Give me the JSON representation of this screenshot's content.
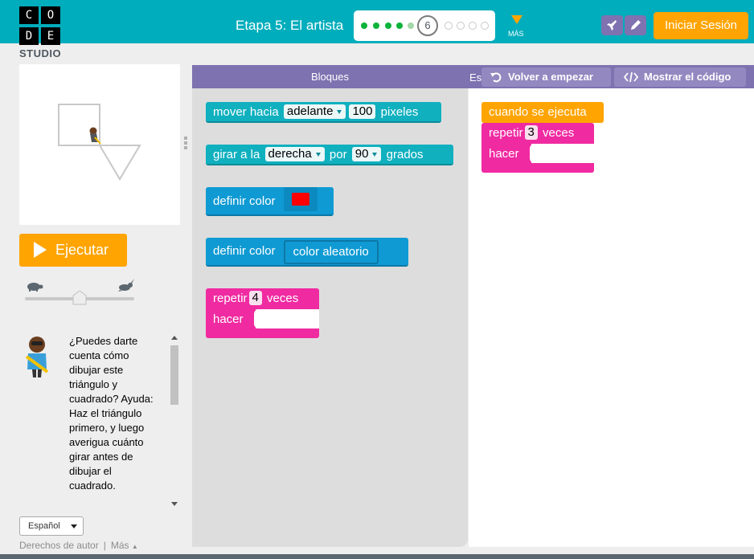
{
  "header": {
    "logo_letters": [
      "C",
      "O",
      "D",
      "E"
    ],
    "logo_sub": "STUDIO",
    "stage_title": "Etapa 5: El artista",
    "current_level": "6",
    "more_label": "MÁS",
    "signin_label": "Iniciar Sesión",
    "icons": [
      "rocket-icon",
      "pencil-icon"
    ]
  },
  "run_button": {
    "label": "Ejecutar"
  },
  "speed_slider": {
    "value": 0.5,
    "slow_icon": "turtle-icon",
    "fast_icon": "rabbit-icon"
  },
  "instructions": {
    "lines": [
      "¿Puedes darte",
      "cuenta cómo",
      "dibujar este",
      "triángulo y",
      "cuadrado? Ayuda:",
      "Haz el triángulo",
      "primero, y luego",
      "averigua cuánto",
      "girar antes de",
      "dibujar el",
      "cuadrado."
    ]
  },
  "footer": {
    "language": "Español",
    "copyright": "Derechos de autor",
    "more": "Más"
  },
  "toolbox": {
    "title": "Bloques",
    "blocks": {
      "move": {
        "label": "mover hacia",
        "direction": "adelante",
        "amount": "100",
        "unit": "pixeles"
      },
      "turn": {
        "label": "girar a la",
        "direction": "derecha",
        "by": "por",
        "amount": "90",
        "unit": "grados"
      },
      "set_color": {
        "label": "definir color",
        "color": "#ff0000"
      },
      "set_random": {
        "label": "definir color",
        "value": "color aleatorio"
      },
      "repeat": {
        "label": "repetir",
        "count": "4",
        "unit": "veces",
        "do": "hacer"
      }
    }
  },
  "workspace": {
    "label_fragment": "Es",
    "reset_label": "Volver a empezar",
    "code_label": "Mostrar el código",
    "when_run": "cuando se ejecuta",
    "repeat": {
      "label": "repetir",
      "count": "3",
      "unit": "veces",
      "do": "hacer"
    }
  },
  "colors": {
    "header_bg": "#00adbc",
    "accent_orange": "#ffa400",
    "purple": "#7e72b0",
    "block_teal": "#10b0bf",
    "block_blue": "#0f9ad3",
    "block_pink": "#f02aa1",
    "progress_done": "#0cb33a"
  }
}
